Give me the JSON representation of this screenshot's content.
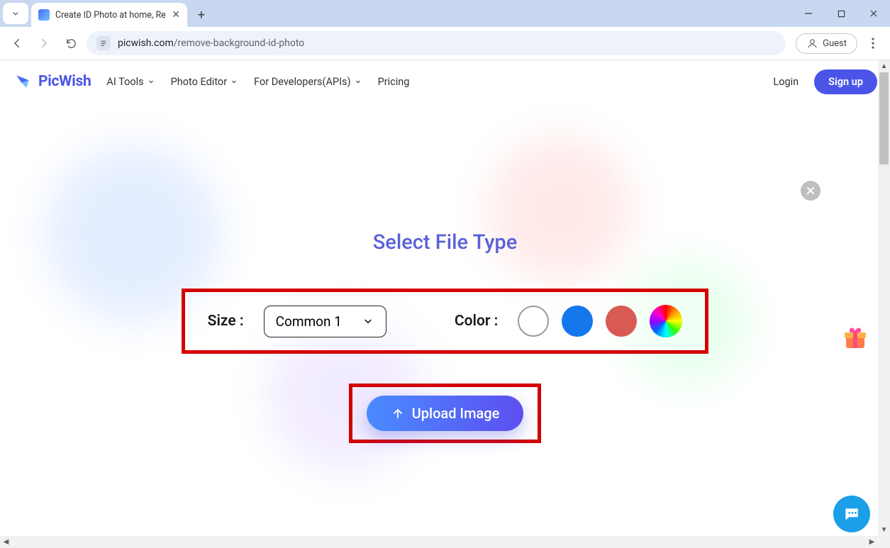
{
  "browser": {
    "tab_title": "Create ID Photo at home, Re",
    "url_host": "picwish.com",
    "url_path": "/remove-background-id-photo",
    "guest_label": "Guest"
  },
  "header": {
    "brand": "PicWish",
    "nav": {
      "ai_tools": "AI Tools",
      "photo_editor": "Photo Editor",
      "developers": "For Developers(APIs)",
      "pricing": "Pricing"
    },
    "login": "Login",
    "signup": "Sign up"
  },
  "modal": {
    "title": "Select File Type",
    "size_label": "Size :",
    "size_value": "Common 1",
    "color_label": "Color :",
    "colors": {
      "white": "#ffffff",
      "blue": "#1477eb",
      "red": "#d85a52",
      "rainbow": "multi"
    },
    "upload_label": "Upload Image"
  }
}
